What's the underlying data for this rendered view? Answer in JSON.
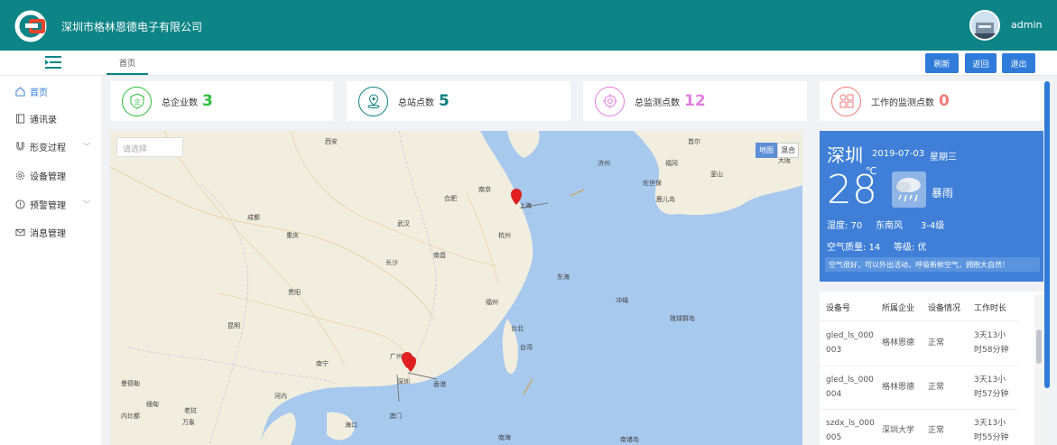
{
  "header": {
    "company": "深圳市格林恩德电子有限公司",
    "user": "admin"
  },
  "topbar": {
    "tab": "首页",
    "refresh": "刷新",
    "back": "返回",
    "logout": "退出"
  },
  "sidebar": {
    "items": [
      {
        "label": "首页",
        "icon": "home-icon"
      },
      {
        "label": "通讯录",
        "icon": "book-icon"
      },
      {
        "label": "形变过程",
        "icon": "magnet-icon"
      },
      {
        "label": "设备管理",
        "icon": "gear-icon"
      },
      {
        "label": "预警管理",
        "icon": "warning-icon"
      },
      {
        "label": "消息管理",
        "icon": "mail-icon"
      }
    ]
  },
  "stats": [
    {
      "label": "总企业数",
      "value": "3",
      "color": "#2dbf3b"
    },
    {
      "label": "总站点数",
      "value": "5",
      "color": "#0d7e80"
    },
    {
      "label": "总监测点数",
      "value": "12",
      "color": "#e47de0"
    },
    {
      "label": "工作的监测点数",
      "value": "0",
      "color": "#f07a7a"
    }
  ],
  "map": {
    "select_placeholder": "请选择",
    "type_map": "地图",
    "type_mixed": "混合",
    "cities": [
      "西安",
      "南京",
      "合肥",
      "上海",
      "成都",
      "武汉",
      "重庆",
      "杭州",
      "长沙",
      "南昌",
      "贵阳",
      "福州",
      "台北",
      "台湾",
      "昆明",
      "南宁",
      "广州",
      "深圳",
      "香港",
      "澳门",
      "海口",
      "河内",
      "东海",
      "冲绳",
      "琉球群岛",
      "首尔",
      "釜山",
      "大阪",
      "福冈",
      "广岛",
      "鹿儿岛",
      "济州",
      "佐世保",
      "南海",
      "曼德勒",
      "老挝",
      "内比都",
      "万象",
      "缅甸",
      "南诸岛"
    ]
  },
  "weather": {
    "city": "深圳",
    "date": "2019-07-03",
    "weekday": "星期三",
    "temp": "28",
    "unit": "℃",
    "condition": "暴雨",
    "humidity": "湿度: 70",
    "wind_dir": "东南风",
    "wind_level": "3-4级",
    "aqi": "空气质量: 14",
    "grade": "等级: 优",
    "tip": "空气很好，可以外出活动，呼吸新鲜空气，拥抱大自然！"
  },
  "table": {
    "headers": [
      "设备号",
      "所属企业",
      "设备情况",
      "工作时长"
    ],
    "rows": [
      {
        "id1": "gled_ls_000",
        "id2": "003",
        "company": "格林恩德",
        "status": "正常",
        "time1": "3天13小",
        "time2": "时58分钟"
      },
      {
        "id1": "gled_ls_000",
        "id2": "004",
        "company": "格林恩德",
        "status": "正常",
        "time1": "3天13小",
        "time2": "时57分钟"
      },
      {
        "id1": "szdx_ls_000",
        "id2": "005",
        "company": "深圳大学",
        "status": "正常",
        "time1": "3天13小",
        "time2": "时55分钟"
      }
    ]
  }
}
